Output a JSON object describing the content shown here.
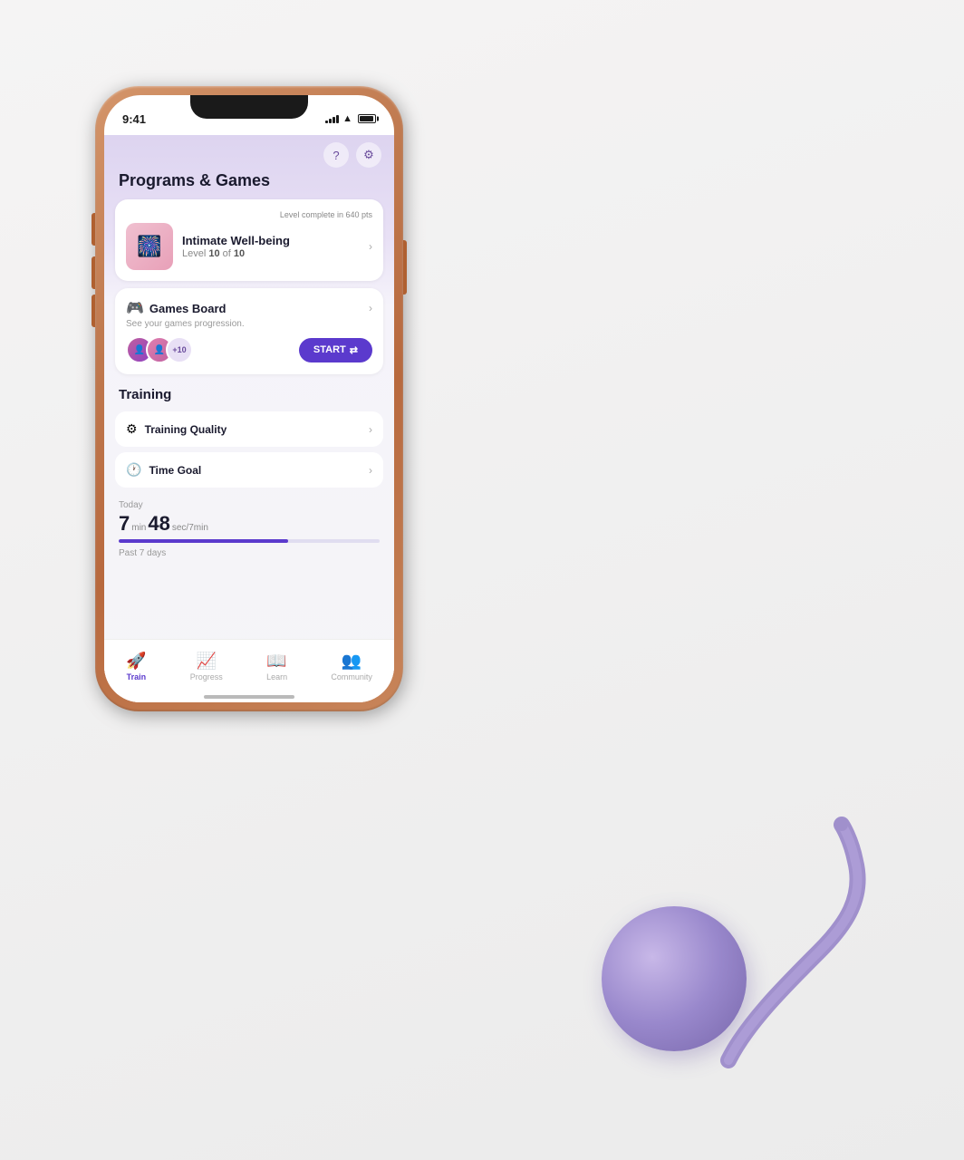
{
  "scene": {
    "background": "#f0eeee"
  },
  "status_bar": {
    "time": "9:41",
    "signal_bars": [
      3,
      5,
      7,
      9,
      11
    ],
    "wifi": "wifi",
    "battery": 85
  },
  "app": {
    "header": {
      "title": "Programs & Games",
      "help_label": "?",
      "settings_label": "⚙"
    },
    "programs_section": {
      "level_badge": "Level complete in 640 pts",
      "intimate_wellbeing": {
        "title": "Intimate Well-being",
        "level_text": "Level 10 of 10",
        "level_num": "10",
        "level_total": "10"
      },
      "games_board": {
        "title": "Games Board",
        "subtitle": "See your games progression.",
        "plus_count": "+10",
        "start_label": "START"
      }
    },
    "training_section": {
      "header": "Training",
      "training_quality": {
        "label": "Training Quality",
        "icon": "⚙"
      },
      "time_goal": {
        "label": "Time Goal",
        "icon": "🕐"
      },
      "today": {
        "label": "Today",
        "minutes": "7",
        "min_unit": "min",
        "seconds": "48",
        "sec_unit": "sec/7min",
        "progress_pct": 65
      },
      "past_7_days": {
        "label": "Past 7 days"
      }
    },
    "bottom_nav": {
      "items": [
        {
          "id": "train",
          "label": "Train",
          "icon": "🚀",
          "active": true
        },
        {
          "id": "progress",
          "label": "Progress",
          "icon": "📈",
          "active": false
        },
        {
          "id": "learn",
          "label": "Learn",
          "icon": "📖",
          "active": false
        },
        {
          "id": "community",
          "label": "Community",
          "icon": "👥",
          "active": false
        }
      ]
    }
  }
}
